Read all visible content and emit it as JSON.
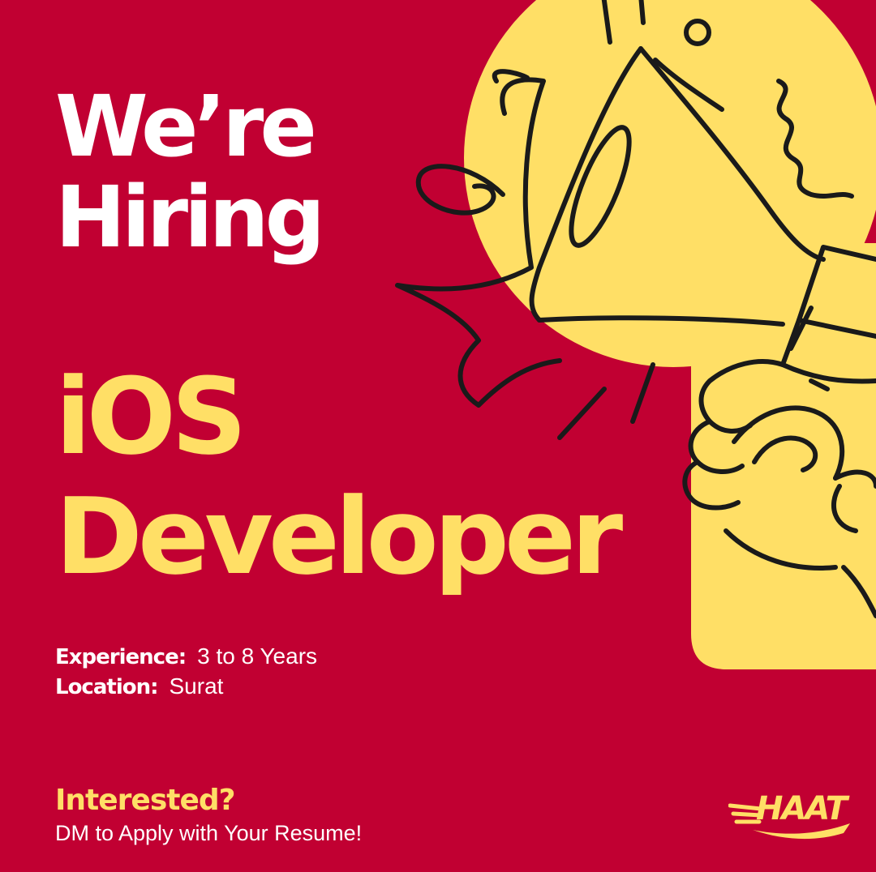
{
  "headline": {
    "line1": "We’re",
    "line2": "Hiring"
  },
  "role": {
    "line1": "iOS",
    "line2": "Developer"
  },
  "details": {
    "experience_label": "Experience:",
    "experience_value": "3 to 8 Years",
    "location_label": "Location:",
    "location_value": "Surat"
  },
  "cta": {
    "question": "Interested?",
    "instruction": "DM to Apply with Your Resume!"
  },
  "brand": {
    "logo_text": "HAAT"
  },
  "illustration": {
    "name": "megaphone-in-hand-icon"
  },
  "colors": {
    "background": "#c10032",
    "accent": "#ffdf66",
    "text": "#ffffff",
    "line": "#1a1a1a"
  }
}
